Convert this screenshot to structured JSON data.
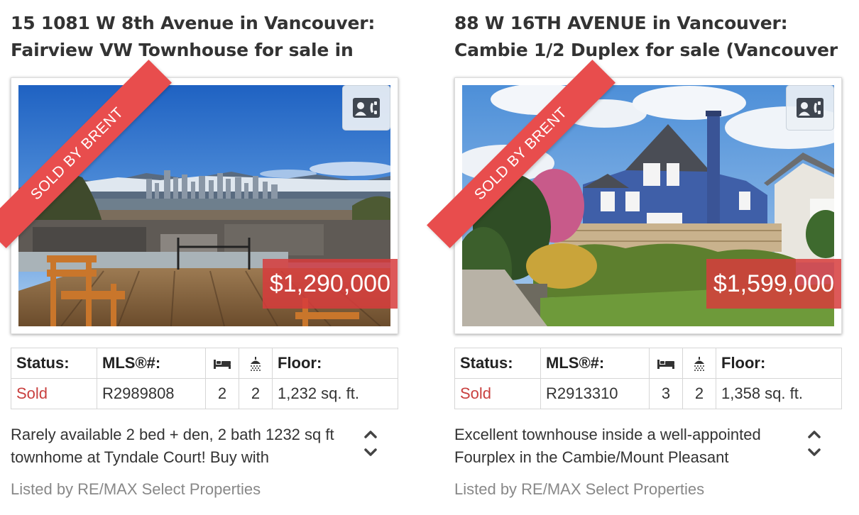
{
  "listings": [
    {
      "title": "15 1081 W 8th Avenue in Vancouver: Fairview VW Townhouse for sale in",
      "ribbon": "SOLD BY BRENT",
      "price": "$1,290,000",
      "table": {
        "headers": {
          "status": "Status:",
          "mls": "MLS®#:",
          "floor": "Floor:"
        },
        "status": "Sold",
        "mls": "R2989808",
        "beds": "2",
        "baths": "2",
        "floor": "1,232 sq. ft."
      },
      "description": "Rarely available 2 bed + den, 2 bath 1232 sq ft townhome at Tyndale Court! Buy with",
      "broker": "Listed by RE/MAX Select Properties"
    },
    {
      "title": "88 W 16TH AVENUE in Vancouver: Cambie 1/2 Duplex for sale (Vancouver",
      "ribbon": "SOLD BY BRENT",
      "price": "$1,599,000",
      "table": {
        "headers": {
          "status": "Status:",
          "mls": "MLS®#:",
          "floor": "Floor:"
        },
        "status": "Sold",
        "mls": "R2913310",
        "beds": "3",
        "baths": "2",
        "floor": "1,358 sq. ft."
      },
      "description": "Excellent townhouse inside a well-appointed Fourplex in the Cambie/Mount Pleasant",
      "broker": "Listed by RE/MAX Select Properties"
    }
  ],
  "icons": {
    "contact": "contact-card-icon",
    "bed": "bed-icon",
    "bath": "shower-icon",
    "scroll_up": "chevron-up-icon",
    "scroll_down": "chevron-down-icon"
  },
  "colors": {
    "sold": "#c9403f",
    "ribbon": "#e84d4d",
    "price_bg": "#d73c3c"
  }
}
